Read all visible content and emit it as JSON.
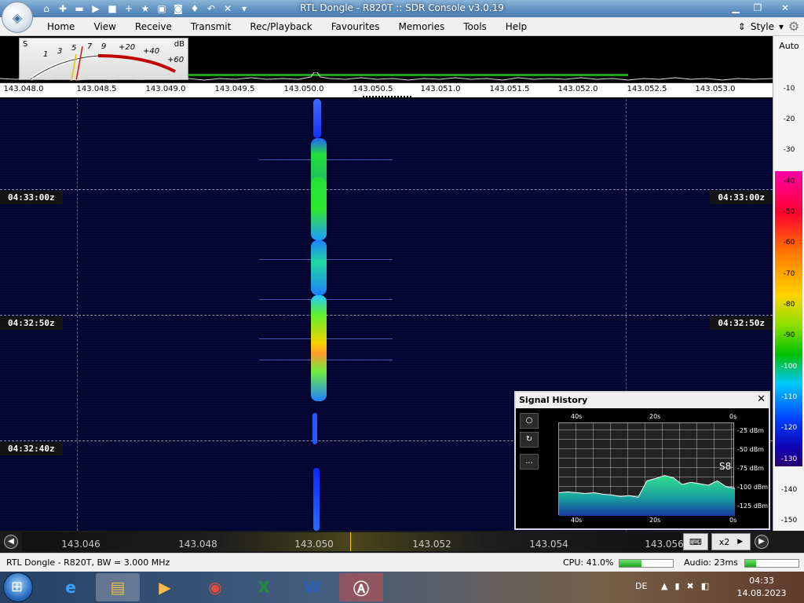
{
  "window": {
    "title": "RTL Dongle - R820T :: SDR Console v3.0.19",
    "minimize_icon": "minimize-icon",
    "maximize_icon": "restore-icon",
    "close_icon": "close-icon"
  },
  "quick_access": [
    "home-icon",
    "lifebuoy-icon",
    "folder-icon",
    "play-icon",
    "stop-icon",
    "plus-icon",
    "star-icon",
    "lock-icon",
    "camera-icon",
    "drop-icon",
    "undo-icon",
    "close-icon",
    "dropdown-arrow-icon"
  ],
  "menu": {
    "items": [
      "Home",
      "View",
      "Receive",
      "Transmit",
      "Rec/Playback",
      "Favourites",
      "Memories",
      "Tools",
      "Help"
    ],
    "style_label": "Style"
  },
  "smeter": {
    "s_label": "S",
    "db_label": "dB",
    "scale": [
      "1",
      "3",
      "5",
      "7",
      "9",
      "+20",
      "+40",
      "+60"
    ]
  },
  "spectrum": {
    "freq_ticks": [
      "143.048.0",
      "143.048.5",
      "143.049.0",
      "143.049.5",
      "143.050.0",
      "143.050.5",
      "143.051.0",
      "143.051.5",
      "143.052.0",
      "143.052.5",
      "143.053.0"
    ]
  },
  "db_scale": {
    "auto_label": "Auto",
    "ticks": [
      "-10",
      "-20",
      "-30",
      "-40",
      "-50",
      "-60",
      "-70",
      "-80",
      "-90",
      "-100",
      "-110",
      "-120",
      "-130",
      "-140",
      "-150"
    ]
  },
  "waterfall": {
    "time_labels": [
      "04:33:00z",
      "04:32:50z",
      "04:32:40z"
    ]
  },
  "signal_history": {
    "title": "Signal History",
    "top_axis": [
      "40s",
      "20s",
      "0s"
    ],
    "bottom_axis": [
      "40s",
      "20s",
      "0s"
    ],
    "y_axis": [
      "-25 dBm",
      "-50 dBm",
      "-75 dBm",
      "-100 dBm",
      "-125 dBm"
    ],
    "s_reading": "S8",
    "side_buttons": [
      "○",
      "↻",
      "..."
    ],
    "chart_data": {
      "type": "area",
      "x": [
        40,
        38,
        36,
        34,
        32,
        30,
        28,
        26,
        24,
        22,
        20,
        18,
        16,
        14,
        12,
        10,
        8,
        6,
        4,
        2,
        0
      ],
      "values": [
        -106,
        -105,
        -106,
        -107,
        -106,
        -108,
        -109,
        -111,
        -110,
        -112,
        -90,
        -87,
        -83,
        -86,
        -95,
        -92,
        -94,
        -96,
        -90,
        -98,
        -100
      ],
      "xlabel": "",
      "ylabel": "",
      "ylim": [
        -137,
        -13
      ]
    }
  },
  "freq_bar": {
    "labels": [
      "143.046",
      "143.048",
      "143.050",
      "143.052",
      "143.054",
      "143.056"
    ],
    "zoom": "x2",
    "keyboard_icon": "keyboard-icon",
    "prev_icon": "rewind-icon",
    "next_icon": "forward-icon"
  },
  "status": {
    "device": "RTL Dongle - R820T, BW = 3.000 MHz",
    "cpu": "CPU: 41.0%",
    "cpu_level": 0.41,
    "audio": "Audio: 23ms",
    "audio_level": 0.2
  },
  "taskbar": {
    "apps": [
      "internet-explorer-icon",
      "file-explorer-icon",
      "media-player-icon",
      "chrome-icon",
      "excel-icon",
      "word-icon",
      "sdr-console-icon"
    ],
    "lang": "DE",
    "time": "04:33",
    "date": "14.08.2023"
  },
  "colors": {
    "waterfall_bg": "#06062a",
    "signal_green": "#22e03a",
    "signal_yellow": "#f5d100",
    "spectrum_green": "#1fa31f",
    "accent_title": "#5d8fc0"
  }
}
